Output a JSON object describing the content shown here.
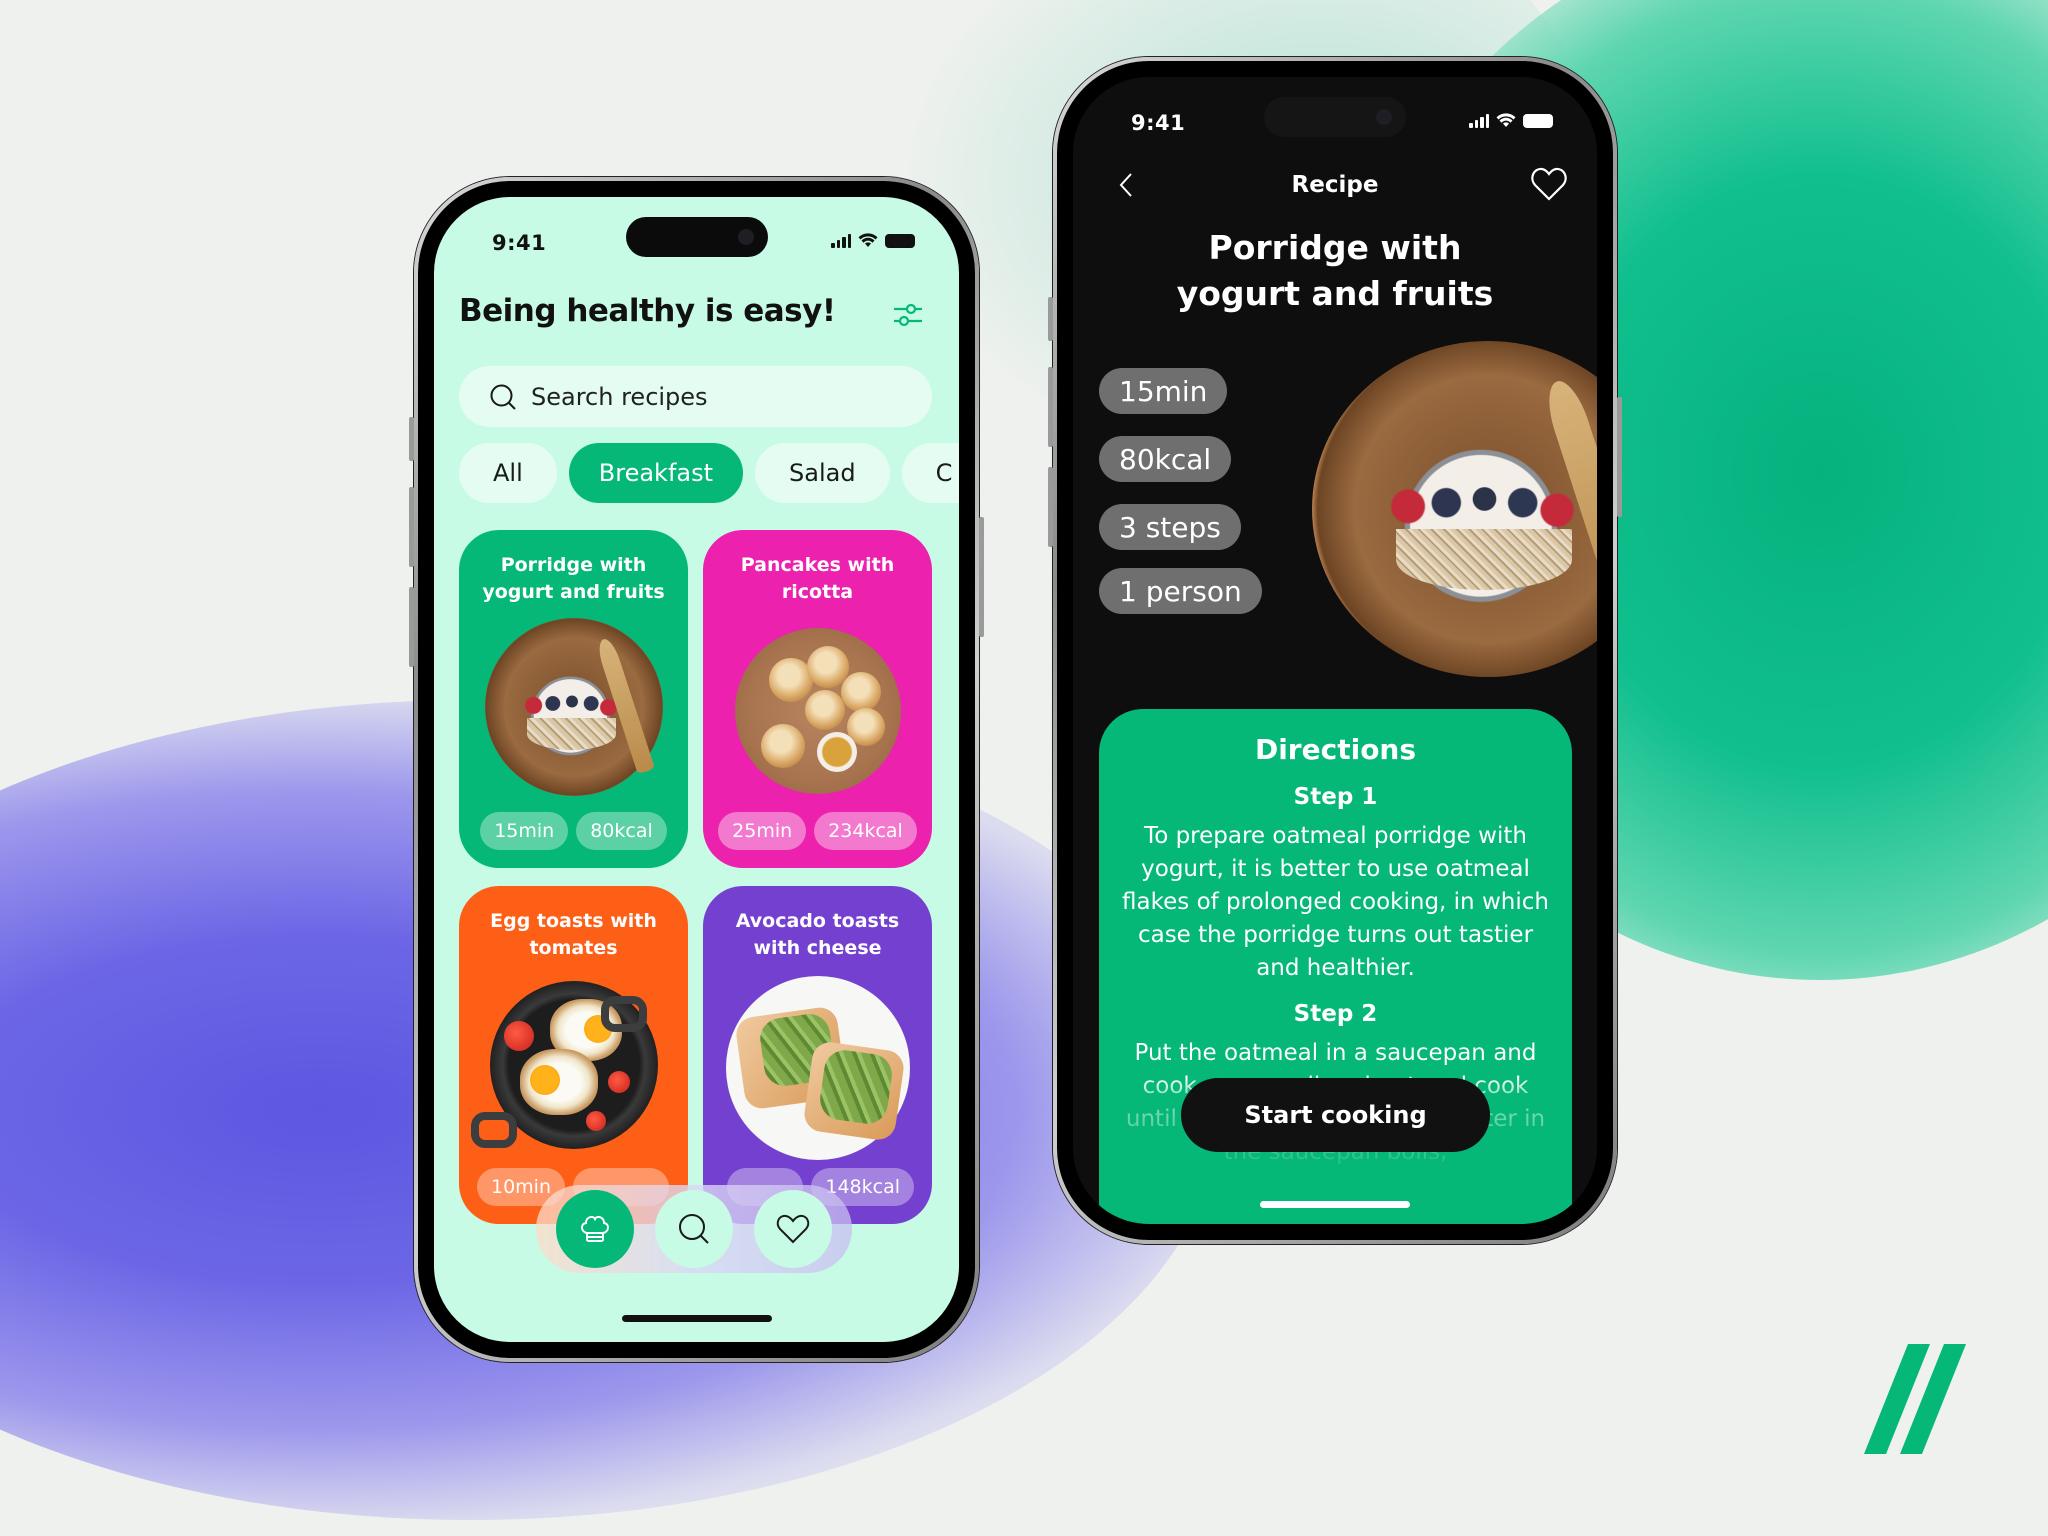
{
  "colors": {
    "accent_green": "#05b877",
    "light_mint": "#c7fbe6",
    "pink": "#ec21ad",
    "orange": "#fd5f17",
    "purple": "#7440cf",
    "dark": "#0e0e0e"
  },
  "left_phone": {
    "status": {
      "time": "9:41"
    },
    "title": "Being healthy is easy!",
    "filter_icon": "sliders-icon",
    "search": {
      "placeholder": "Search recipes",
      "value": ""
    },
    "chips": [
      {
        "label": "All",
        "active": false
      },
      {
        "label": "Breakfast",
        "active": true
      },
      {
        "label": "Salad",
        "active": false
      },
      {
        "label": "C",
        "active": false
      }
    ],
    "cards": [
      {
        "title": "Porridge with yogurt and fruits",
        "time": "15min",
        "kcal": "80kcal",
        "color": "#05b877"
      },
      {
        "title": "Pancakes with ricotta",
        "time": "25min",
        "kcal": "234kcal",
        "color": "#ec21ad"
      },
      {
        "title": "Egg toasts with tomates",
        "time": "10min",
        "kcal": "",
        "color": "#fd5f17"
      },
      {
        "title": "Avocado toasts with cheese",
        "time": "",
        "kcal": "148kcal",
        "color": "#7440cf"
      }
    ],
    "nav": [
      {
        "icon": "chef-hat-icon",
        "active": true
      },
      {
        "icon": "search-icon",
        "active": false
      },
      {
        "icon": "heart-icon",
        "active": false
      }
    ]
  },
  "right_phone": {
    "status": {
      "time": "9:41"
    },
    "header_title": "Recipe",
    "recipe_title_line1": "Porridge with",
    "recipe_title_line2": "yogurt and fruits",
    "tags": [
      "15min",
      "80kcal",
      "3 steps",
      "1 person"
    ],
    "directions": {
      "title": "Directions",
      "steps": [
        {
          "title": "Step 1",
          "body": "To prepare oatmeal porridge with yogurt, it is better to use oatmeal flakes of prolonged cooking, in which case the porridge turns out tastier and healthier."
        },
        {
          "title": "Step 2",
          "body": "Put the oatmeal in a saucepan and cook over medium heat and cook until boiling. As soon as the water in the saucepan boils,"
        }
      ]
    },
    "start_button": "Start cooking"
  }
}
